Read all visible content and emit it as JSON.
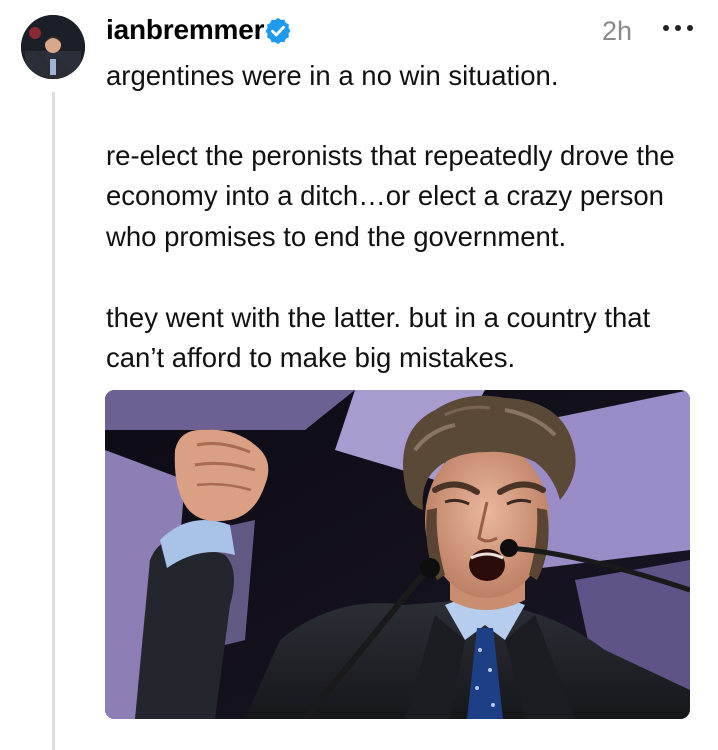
{
  "post": {
    "username": "ianbremmer",
    "verified": true,
    "timestamp": "2h",
    "text_lines": [
      "argentines were in a no win situation.",
      "re-elect the peronists that repeatedly drove the",
      "economy into a ditch…or elect a crazy person",
      "who promises to end the government.",
      "they went with the latter. but in a country that",
      "can’t afford to make big mistakes."
    ],
    "icons": {
      "verified": "verified-badge-icon",
      "more": "more-options-icon"
    }
  },
  "colors": {
    "verified_badge": "#1d9bf0",
    "timestamp": "#8a8a8a",
    "thread_line": "#dcdcdc"
  }
}
